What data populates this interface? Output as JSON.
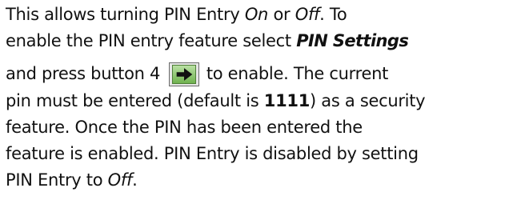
{
  "paragraph": {
    "line1": {
      "a": "This allows turning PIN Entry ",
      "on": "On",
      "b": " or ",
      "off": "Off",
      "c": ". To"
    },
    "line2": {
      "a": "enable the PIN entry feature select ",
      "pin_settings": "PIN Settings"
    },
    "line3": {
      "a": "and press button 4 ",
      "icon": "right-arrow-key-icon",
      "b": " to enable. The current"
    },
    "line4": {
      "a": "pin must be entered (default is ",
      "default_pin": "1111",
      "b": ") as a security"
    },
    "line5": "feature. Once the PIN has been entered the",
    "line6": "feature is enabled. PIN Entry is disabled by setting",
    "line7": {
      "a": "PIN Entry to ",
      "off": "Off",
      "b": "."
    }
  },
  "colors": {
    "text": "#111111",
    "key_green": "#6fb24e"
  }
}
